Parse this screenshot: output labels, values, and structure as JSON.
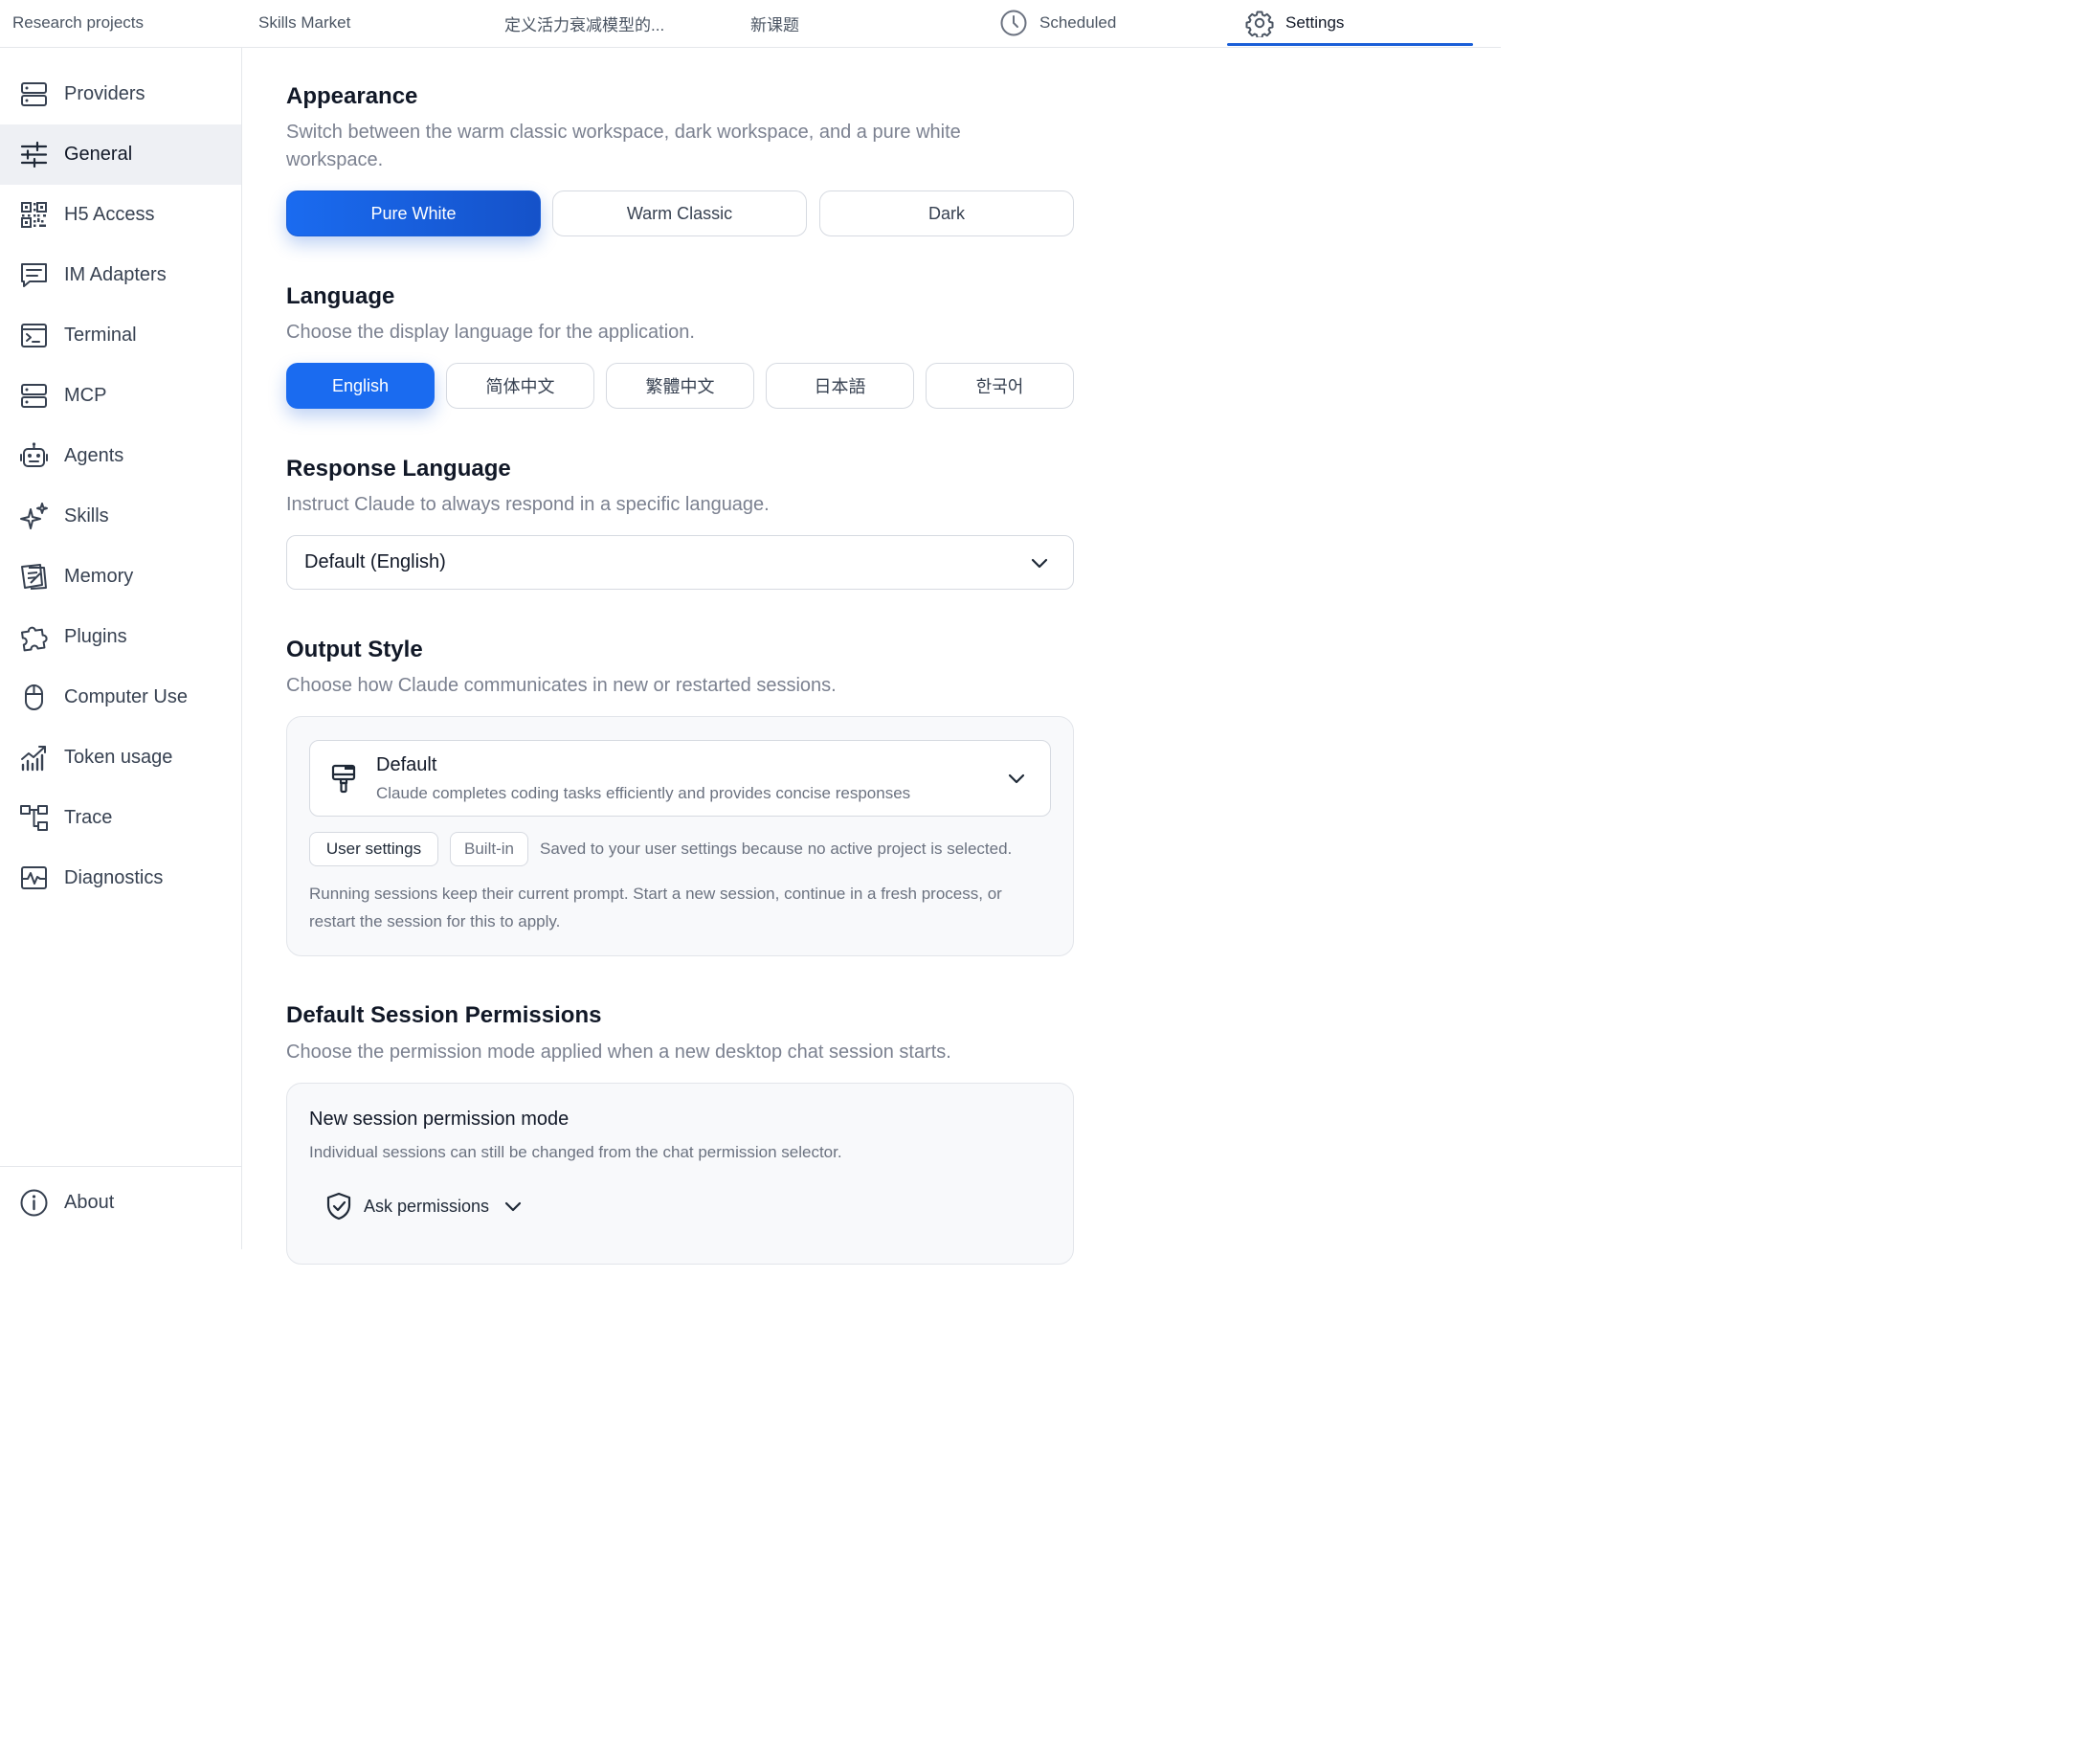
{
  "tabs": [
    {
      "label": "Research projects"
    },
    {
      "label": "Skills Market"
    },
    {
      "label": "定义活力衰减模型的..."
    },
    {
      "label": "新课题"
    },
    {
      "label": "Scheduled",
      "icon": "clock-icon"
    },
    {
      "label": "Settings",
      "icon": "gear-icon",
      "active": true
    }
  ],
  "sidebar": {
    "items": [
      {
        "label": "Providers",
        "icon": "server-icon"
      },
      {
        "label": "General",
        "icon": "sliders-icon",
        "active": true
      },
      {
        "label": "H5 Access",
        "icon": "qr-code-icon"
      },
      {
        "label": "IM Adapters",
        "icon": "message-icon"
      },
      {
        "label": "Terminal",
        "icon": "terminal-icon"
      },
      {
        "label": "MCP",
        "icon": "server-icon"
      },
      {
        "label": "Agents",
        "icon": "robot-icon"
      },
      {
        "label": "Skills",
        "icon": "sparkles-icon"
      },
      {
        "label": "Memory",
        "icon": "memory-icon"
      },
      {
        "label": "Plugins",
        "icon": "puzzle-icon"
      },
      {
        "label": "Computer Use",
        "icon": "mouse-icon"
      },
      {
        "label": "Token usage",
        "icon": "chart-icon"
      },
      {
        "label": "Trace",
        "icon": "hierarchy-icon"
      },
      {
        "label": "Diagnostics",
        "icon": "pulse-icon"
      }
    ],
    "about": {
      "label": "About",
      "icon": "info-icon"
    }
  },
  "appearance": {
    "title": "Appearance",
    "desc": "Switch between the warm classic workspace, dark workspace, and a pure white workspace.",
    "options": [
      "Pure White",
      "Warm Classic",
      "Dark"
    ],
    "selected": "Pure White"
  },
  "language": {
    "title": "Language",
    "desc": "Choose the display language for the application.",
    "options": [
      "English",
      "简体中文",
      "繁體中文",
      "日本語",
      "한국어"
    ],
    "selected": "English"
  },
  "response_language": {
    "title": "Response Language",
    "desc": "Instruct Claude to always respond in a specific language.",
    "value": "Default (English)"
  },
  "output_style": {
    "title": "Output Style",
    "desc": "Choose how Claude communicates in new or restarted sessions.",
    "selected_title": "Default",
    "selected_desc": "Claude completes coding tasks efficiently and provides concise responses",
    "scope_user": "User settings",
    "scope_builtin": "Built-in",
    "saved_note": "Saved to your user settings because no active project is selected.",
    "note": "Running sessions keep their current prompt. Start a new session, continue in a fresh process, or restart the session for this to apply."
  },
  "permissions": {
    "title": "Default Session Permissions",
    "desc": "Choose the permission mode applied when a new desktop chat session starts.",
    "card_title": "New session permission mode",
    "card_desc": "Individual sessions can still be changed from the chat permission selector.",
    "mode": "Ask permissions"
  },
  "colors": {
    "accent": "#1a6bf0",
    "active_nav_bg": "#eef0f4",
    "muted_text": "#7b8190"
  }
}
